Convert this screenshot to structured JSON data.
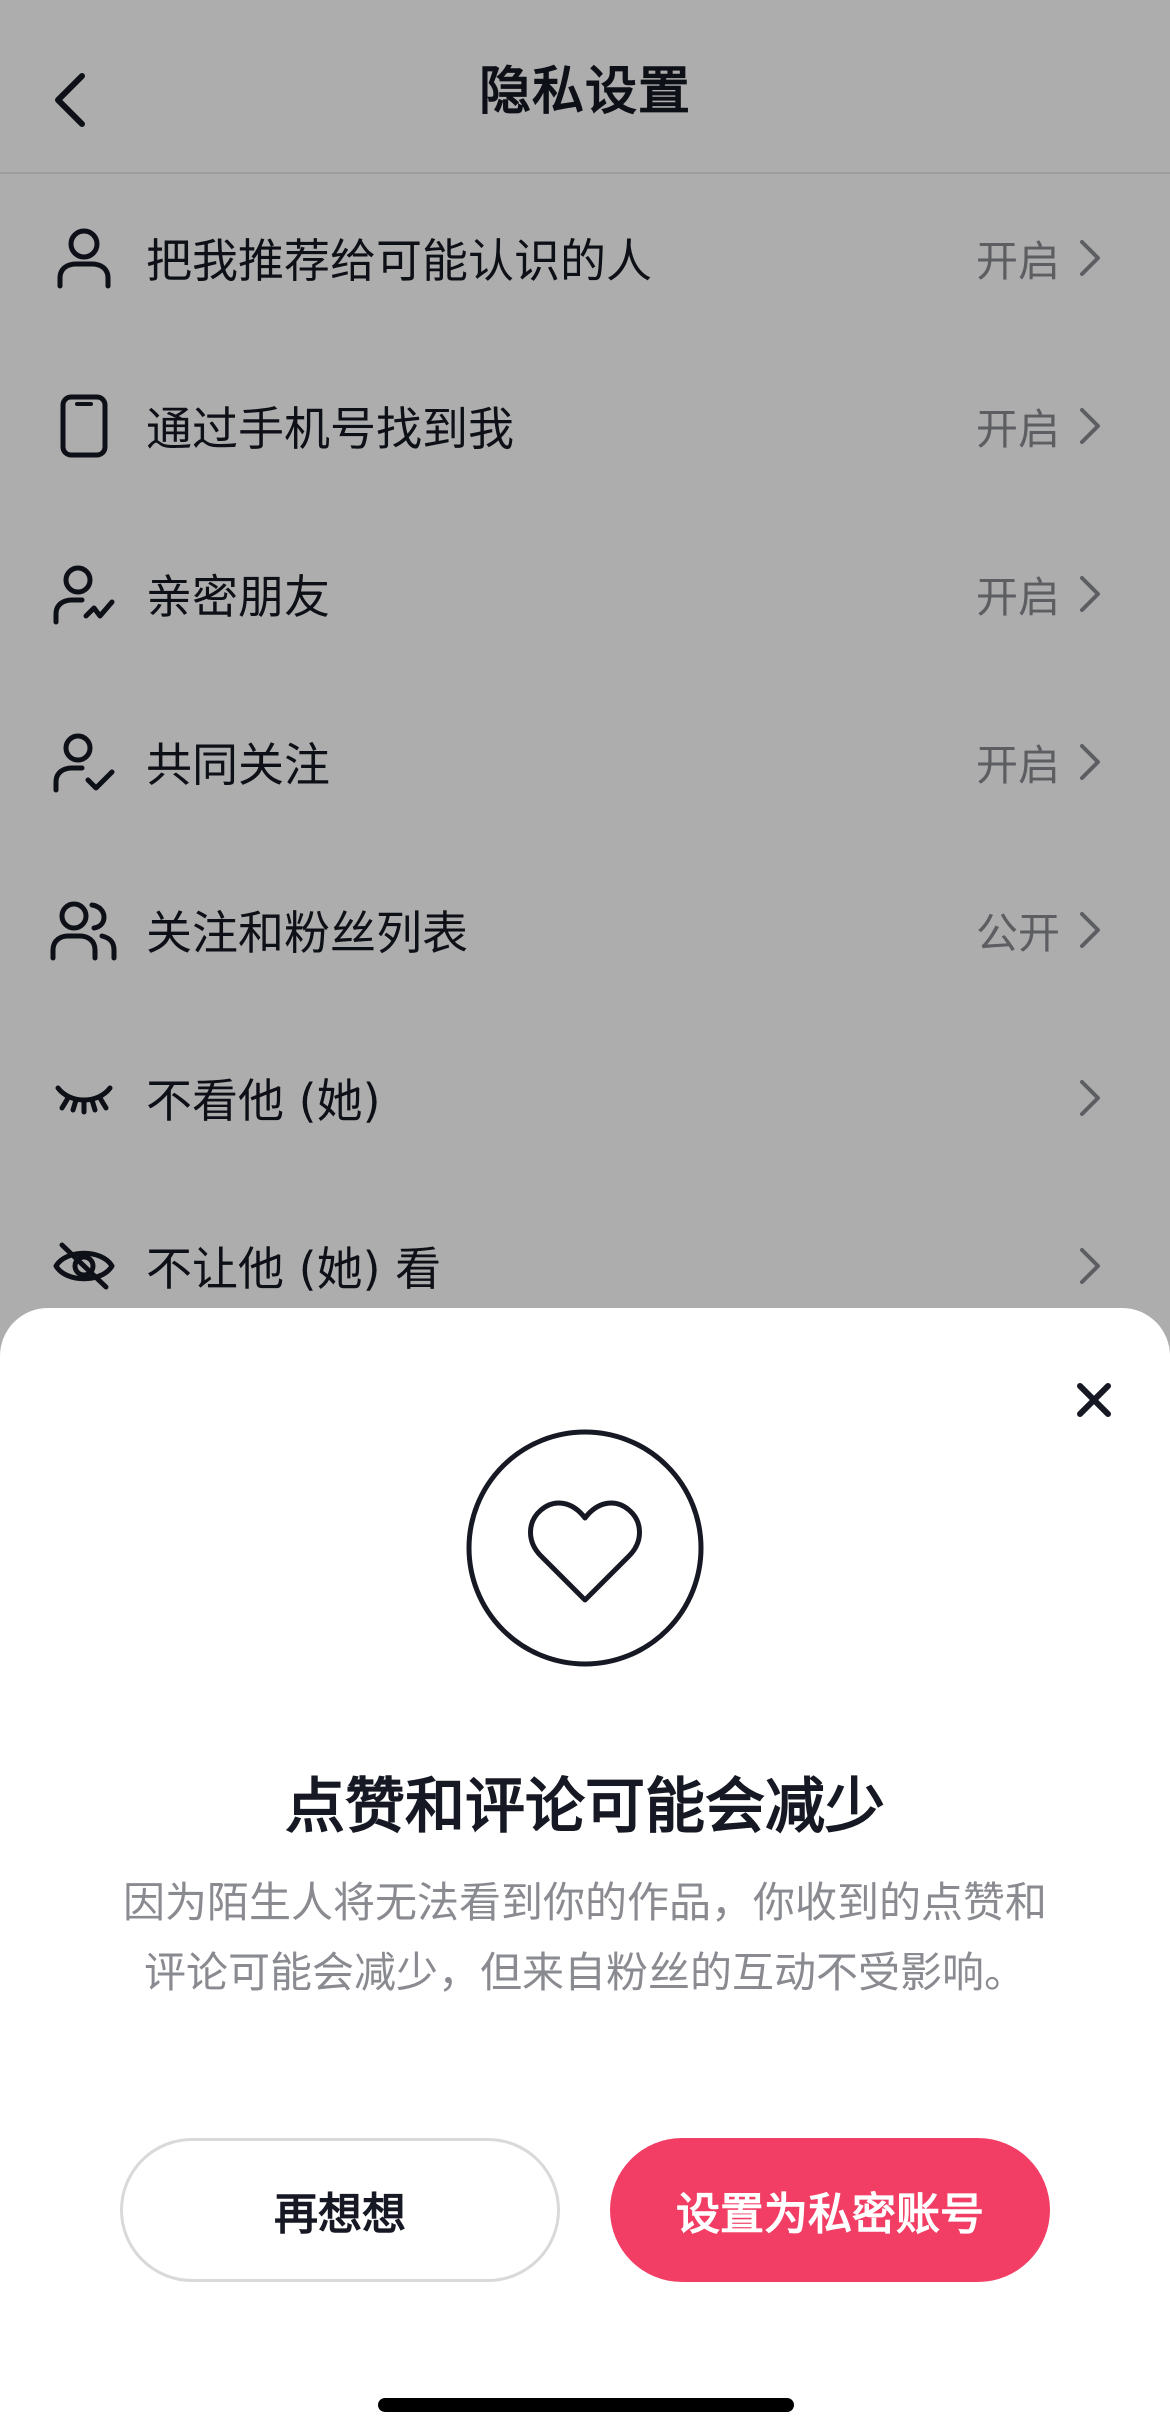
{
  "header": {
    "title": "隐私设置"
  },
  "list": {
    "items": [
      {
        "label": "把我推荐给可能认识的人",
        "value": "开启",
        "icon": "person-icon"
      },
      {
        "label": "通过手机号找到我",
        "value": "开启",
        "icon": "phone-icon"
      },
      {
        "label": "亲密朋友",
        "value": "开启",
        "icon": "close-friend-icon"
      },
      {
        "label": "共同关注",
        "value": "开启",
        "icon": "person-check-icon"
      },
      {
        "label": "关注和粉丝列表",
        "value": "公开",
        "icon": "people-icon"
      },
      {
        "label": "不看他 (她)",
        "value": "",
        "icon": "eye-closed-icon"
      },
      {
        "label": "不让他 (她) 看",
        "value": "",
        "icon": "eye-off-icon"
      }
    ]
  },
  "sheet": {
    "title": "点赞和评论可能会减少",
    "description": "因为陌生人将无法看到你的作品，你收到的点赞和评论可能会减少，但来自粉丝的互动不受影响。",
    "secondary_button": "再想想",
    "primary_button": "设置为私密账号",
    "icon": "heart-icon"
  },
  "colors": {
    "primary": "#f23e64",
    "text": "#161823",
    "secondary_text": "#8a8b91"
  }
}
